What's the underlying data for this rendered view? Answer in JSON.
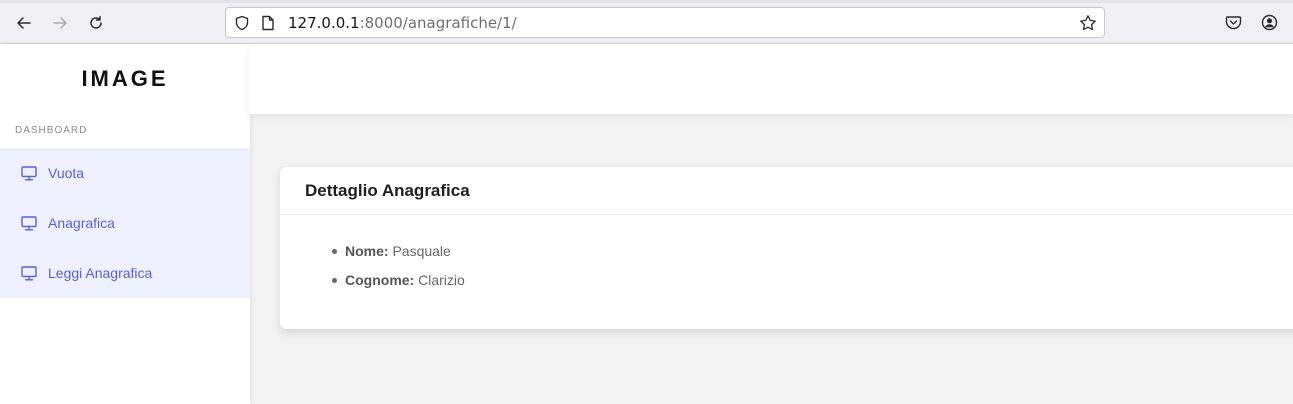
{
  "browser": {
    "url_host": "127.0.0.1",
    "url_rest": ":8000/anagrafiche/1/",
    "icons": [
      "back-icon",
      "forward-icon",
      "reload-icon",
      "shield-icon",
      "page-icon",
      "bookmark-star-icon",
      "pocket-icon",
      "account-icon"
    ]
  },
  "sidebar": {
    "logo": "IMAGE",
    "section_label": "DASHBOARD",
    "items": [
      {
        "label": "Vuota",
        "icon": "monitor-icon"
      },
      {
        "label": "Anagrafica",
        "icon": "monitor-icon"
      },
      {
        "label": "Leggi Anagrafica",
        "icon": "monitor-icon"
      }
    ]
  },
  "card": {
    "title": "Dettaglio Anagrafica",
    "fields": [
      {
        "key": "Nome:",
        "value": "Pasquale"
      },
      {
        "key": "Cognome:",
        "value": "Clarizio"
      }
    ]
  },
  "colors": {
    "accent": "#5a5fd6",
    "menu_bg": "#eef0fd",
    "page_bg": "#f3f3f3"
  }
}
